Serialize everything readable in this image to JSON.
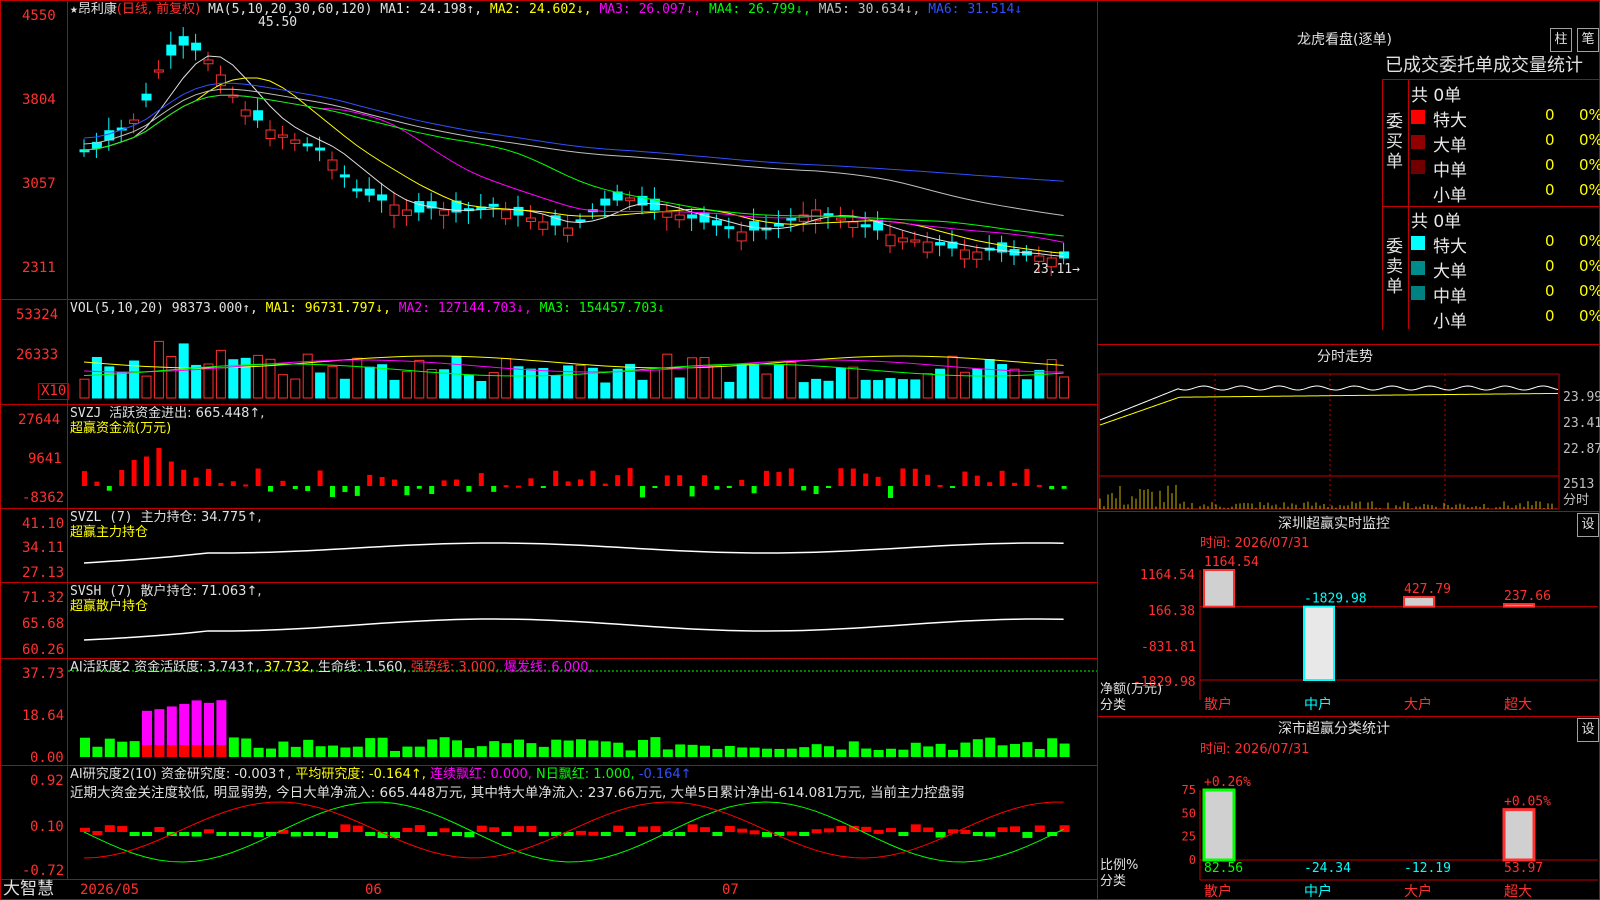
{
  "stock_name": "昂利康",
  "main_chart": {
    "title_star": "★",
    "period_label": "(日线, 前复权)",
    "ma_spec": "MA(5,10,20,30,60,120)",
    "ma1": "MA1: 24.198↑,",
    "ma2": "MA2: 24.602↓,",
    "ma3": "MA3: 26.097↓,",
    "ma4": "MA4: 26.799↓,",
    "ma5": "MA5: 30.634↓,",
    "ma6": "MA6: 31.514↓",
    "y_ticks": [
      "4550",
      "3804",
      "3057",
      "2311"
    ],
    "high_label": "45.50",
    "low_label": "23.11→",
    "last_axis_label": "23.11"
  },
  "vol_panel": {
    "title": "VOL(5,10,20)",
    "value": "98373.000↑,",
    "ma1": "MA1: 96731.797↓,",
    "ma2": "MA2: 127144.703↓,",
    "ma3": "MA3: 154457.703↓",
    "y_ticks": [
      "53324",
      "26333"
    ],
    "unit": "X10"
  },
  "svzj_panel": {
    "title": "SVZJ",
    "name": "活跃资金进出: 665.448↑,",
    "subtitle": "超赢资金流(万元)",
    "y_ticks": [
      "27644",
      "9641",
      "-8362"
    ]
  },
  "svzl_panel": {
    "title": "SVZL (7)",
    "name": "主力持仓: 34.775↑,",
    "subtitle": "超赢主力持仓",
    "y_ticks": [
      "41.10",
      "34.11",
      "27.13"
    ]
  },
  "svsh_panel": {
    "title": "SVSH (7)",
    "name": "散户持仓: 71.063↑,",
    "subtitle": "超赢散户持仓",
    "y_ticks": [
      "71.32",
      "65.68",
      "60.26"
    ]
  },
  "ai_active_panel": {
    "title": "AI活跃度2",
    "f1": "资金活跃度: 3.743↑,",
    "f2": "37.732,",
    "f3": "生命线: 1.560,",
    "f4": "强势线: 3.000,",
    "f5": "爆发线: 6.000,",
    "y_ticks": [
      "37.73",
      "18.64",
      "0.00"
    ]
  },
  "ai_research_panel": {
    "title": "AI研究度2(10)",
    "f1": "资金研究度: -0.003↑,",
    "f2": "平均研究度: -0.164↑,",
    "f3": "连续飘红: 0.000,",
    "f4": "N日飘红: 1.000,",
    "f5": "-0.164↑",
    "commentary": "近期大资金关注度较低, 明显弱势, 今日大单净流入: 665.448万元, 其中特大单净流入: 237.66万元, 大单5日累计净出-614.081万元, 当前主力控盘弱",
    "y_ticks": [
      "0.92",
      "0.10",
      "-0.72"
    ]
  },
  "x_axis": {
    "brand": "大智慧",
    "labels": [
      "2026/05",
      "06",
      "07"
    ]
  },
  "dragon_tiger": {
    "title": "龙虎看盘(逐单)",
    "btn1": "柱",
    "btn2": "笔",
    "tab_label": "已成交委托单成交量统计",
    "buy_side": "委买单",
    "sell_side": "委卖单",
    "buy_total": "共 0单",
    "sell_total": "共 0单",
    "buy_rows": [
      {
        "name": "特大",
        "count": "0",
        "pct": "0%",
        "color": "#ff0000"
      },
      {
        "name": "大单",
        "count": "0",
        "pct": "0%",
        "color": "#900000"
      },
      {
        "name": "中单",
        "count": "0",
        "pct": "0%",
        "color": "#700000"
      },
      {
        "name": "小单",
        "count": "0",
        "pct": "0%",
        "color": "#000000"
      }
    ],
    "sell_rows": [
      {
        "name": "特大",
        "count": "0",
        "pct": "0%",
        "color": "#00ffff"
      },
      {
        "name": "大单",
        "count": "0",
        "pct": "0%",
        "color": "#008b8b"
      },
      {
        "name": "中单",
        "count": "0",
        "pct": "0%",
        "color": "#008080"
      },
      {
        "name": "小单",
        "count": "0",
        "pct": "0%",
        "color": "#000000"
      }
    ]
  },
  "intraday": {
    "title": "分时走势",
    "price_labels": [
      "23.99",
      "23.41",
      "22.87"
    ],
    "vol_label": "2513",
    "unit_label": "分时"
  },
  "sz_monitor": {
    "title": "深圳超赢实时监控",
    "btn": "设",
    "time": "时间: 2026/07/31",
    "y_ticks": [
      "1164.54",
      "166.38",
      "-831.81",
      "-1829.98"
    ],
    "unit_label": "净额(万元)",
    "cat_label": "分类",
    "chart_data": {
      "type": "bar",
      "categories": [
        "散户",
        "中户",
        "大户",
        "超大"
      ],
      "values": [
        1164.54,
        -1829.98,
        427.79,
        237.66
      ],
      "value_labels": [
        "1164.54",
        "-1829.98",
        "427.79",
        "237.66"
      ],
      "ylim": [
        -1829.98,
        1164.54
      ]
    }
  },
  "sz_class": {
    "title": "深市超赢分类统计",
    "btn": "设",
    "time": "时间: 2026/07/31",
    "y_ticks": [
      "75",
      "50",
      "25",
      "0"
    ],
    "unit_label": "比例%",
    "cat_label": "分类",
    "chart_data": {
      "type": "bar",
      "categories": [
        "散户",
        "中户",
        "大户",
        "超大"
      ],
      "values": [
        82.56,
        -24.34,
        -12.19,
        53.97
      ],
      "value_labels": [
        "82.56",
        "-24.34",
        "-12.19",
        "53.97"
      ],
      "top_labels": [
        "+0.26%",
        "",
        "",
        "+0.05%"
      ],
      "ylim": [
        0,
        75
      ]
    }
  }
}
